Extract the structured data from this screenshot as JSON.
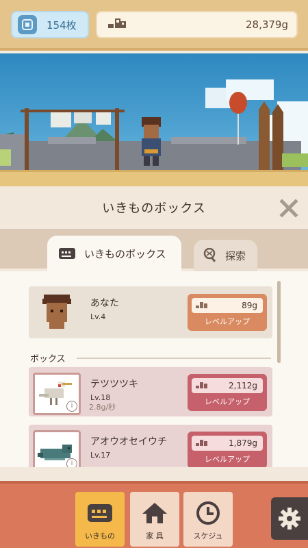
{
  "header": {
    "ticket_icon": "ticket-badge-icon",
    "ticket_count": "154枚",
    "money_icon": "footprint-coin-icon",
    "money_value": "28,379g"
  },
  "panel": {
    "title": "いきものボックス",
    "tabs": [
      {
        "label": "いきものボックス",
        "icon": "creature-box-icon",
        "active": true
      },
      {
        "label": "探索",
        "icon": "net-icon",
        "active": false
      }
    ]
  },
  "player": {
    "name": "あなた",
    "level": "Lv.4",
    "upgrade_price": "89g",
    "upgrade_label": "レベルアップ"
  },
  "section_label": "ボックス",
  "creatures": [
    {
      "name": "テツツツキ",
      "level": "Lv.18",
      "rate": "2.8g/秒",
      "upgrade_price": "2,112g",
      "upgrade_label": "レベルアップ"
    },
    {
      "name": "アオウオセイウチ",
      "level": "Lv.17",
      "rate": "",
      "upgrade_price": "1,879g",
      "upgrade_label": "レベルアップ"
    }
  ],
  "nav": [
    {
      "label": "いきもの",
      "icon": "creature-icon",
      "active": true
    },
    {
      "label": "家 具",
      "icon": "house-icon",
      "active": false
    },
    {
      "label": "スケジュ",
      "icon": "clock-icon",
      "active": false
    }
  ],
  "settings_icon": "gear-icon",
  "colors": {
    "top_bar": "#e5c48b",
    "sky": "#2e88c0",
    "bottom_bar": "#d9785a",
    "level_up_orange": "#d98a60",
    "level_up_pink": "#c6606a",
    "active_nav": "#f4b94a"
  }
}
